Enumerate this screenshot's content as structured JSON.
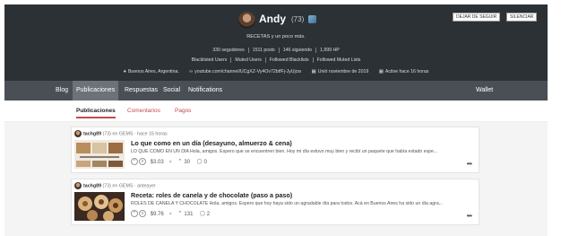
{
  "profile": {
    "name": "Andy",
    "reputation": "(73)",
    "about": "RECETAS y un poco más.",
    "stats": [
      "330 seguidores",
      "1511 posts",
      "146 siguiendo",
      "1,999 HP"
    ],
    "links": [
      "Blacklisted Users",
      "Muted Users",
      "Followed Blacklists",
      "Followed Muted Lists"
    ],
    "location": "Buenos Aires, Argentina.",
    "website": "youtube.com/channel/UCgXZ-Vy4Ov72btfFj-JyUjcw",
    "joined": "Unió noviembre de 2019",
    "active": "Active hace 16 horas",
    "buttons": {
      "unfollow": "DEJAR DE SEGUIR",
      "mute": "SILENCIAR"
    }
  },
  "nav": {
    "blog": "Blog",
    "posts": "Publicaciones",
    "replies": "Respuestas",
    "social": "Social",
    "notifications": "Notifications",
    "wallet": "Wallet"
  },
  "subtabs": {
    "posts": "Publicaciones",
    "comments": "Comentarios",
    "payouts": "Pagos"
  },
  "posts": [
    {
      "author": "tachg89",
      "rep": "(73)",
      "community": "en GEMS",
      "time": "hace 16 horas",
      "title": "Lo que como en un día (desayuno, almuerzo & cena)",
      "excerpt": "LO QUE COMO EN UN DÍA Hola, amigos. Espero que se encuentren bien. Hoy mi día estuvo muy bien y recibí un paquete que había estado espe...",
      "payout": "$3.03",
      "votes": "30",
      "comments": "0"
    },
    {
      "author": "tachg89",
      "rep": "(73)",
      "community": "en GEMS",
      "time": "anteayer",
      "title": "Receta: roles de canela y de chocolate (paso a paso)",
      "excerpt": "ROLES DE CANELA Y CHOCOLATE Hola, amigos. Espero que hoy haya sido un agradable día para todos. Acá en Buenos Aires ha sido un día agra...",
      "payout": "$9.76",
      "votes": "131",
      "comments": "2"
    }
  ]
}
